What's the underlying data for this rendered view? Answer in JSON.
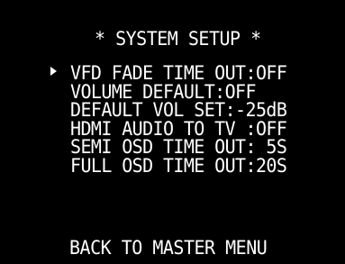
{
  "osd": {
    "title": "* SYSTEM SETUP *",
    "cursor_icon": "triangle-right-icon",
    "items": [
      {
        "label": "VFD FADE TIME OUT:OFF"
      },
      {
        "label": "VOLUME DEFAULT:OFF"
      },
      {
        "label": "DEFAULT VOL SET:-25dB"
      },
      {
        "label": "HDMI AUDIO TO TV :OFF"
      },
      {
        "label": "SEMI OSD TIME OUT: 5S"
      },
      {
        "label": "FULL OSD TIME OUT:20S"
      }
    ],
    "back_label": "BACK TO MASTER MENU",
    "background_color": "#000000",
    "text_color": "#ffffff"
  }
}
